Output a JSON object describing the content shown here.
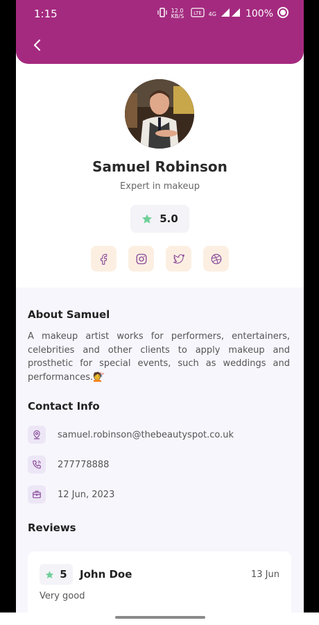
{
  "status_bar": {
    "time": "1:15",
    "net_speed": "12.0 KB/S",
    "network": "4G",
    "battery": "100%"
  },
  "profile": {
    "name": "Samuel Robinson",
    "subtitle": "Expert in makeup",
    "rating": "5.0",
    "socials": [
      "facebook-icon",
      "instagram-icon",
      "twitter-icon",
      "dribbble-icon"
    ]
  },
  "about": {
    "title": "About Samuel",
    "text": "A makeup artist works for performers, entertainers, celebrities and other clients to apply makeup and prosthetic for special events, such as weddings and performances.💇"
  },
  "contact": {
    "title": "Contact Info",
    "email": "samuel.robinson@thebeautyspot.co.uk",
    "phone": "277778888",
    "date": "12 Jun, 2023"
  },
  "reviews": {
    "title": "Reviews",
    "items": [
      {
        "rating": "5",
        "name": "John Doe",
        "date": "13 Jun",
        "text": "Very good"
      }
    ]
  },
  "colors": {
    "header": "#a42a7f",
    "star": "#6fcf97",
    "social_bg": "#fcefe2",
    "icon": "#8a4a9a"
  }
}
